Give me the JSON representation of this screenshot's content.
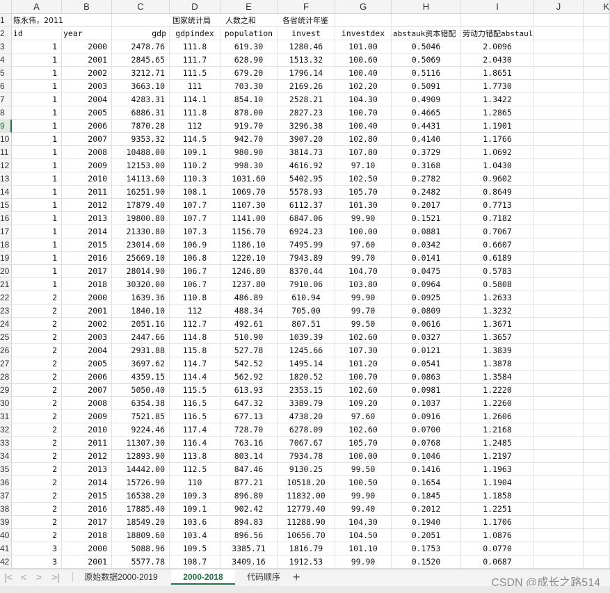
{
  "columns": [
    "A",
    "B",
    "C",
    "D",
    "E",
    "F",
    "G",
    "H",
    "I",
    "J",
    "K"
  ],
  "header_rows": {
    "row1": {
      "rownum": "1",
      "A": "陈永伟，2011",
      "D": "国家统计局",
      "E": "人数之和",
      "F": "各省统计年鉴"
    },
    "row2": {
      "rownum": "2",
      "A": "id",
      "B": "year",
      "C": "gdp",
      "D": "gdpindex",
      "E": "population",
      "F": "invest",
      "G": "investdex",
      "H": "abstauk资本错配",
      "I": "劳动力错配abstaul"
    }
  },
  "rows": [
    {
      "rn": "3",
      "id": "1",
      "year": "2000",
      "gdp": "2478.76",
      "gdpindex": "111.8",
      "population": "619.30",
      "invest": "1280.46",
      "investdex": "101.00",
      "abstauk": "0.5046",
      "abstaul": "2.0096"
    },
    {
      "rn": "4",
      "id": "1",
      "year": "2001",
      "gdp": "2845.65",
      "gdpindex": "111.7",
      "population": "628.90",
      "invest": "1513.32",
      "investdex": "100.60",
      "abstauk": "0.5069",
      "abstaul": "2.0430"
    },
    {
      "rn": "5",
      "id": "1",
      "year": "2002",
      "gdp": "3212.71",
      "gdpindex": "111.5",
      "population": "679.20",
      "invest": "1796.14",
      "investdex": "100.40",
      "abstauk": "0.5116",
      "abstaul": "1.8651"
    },
    {
      "rn": "6",
      "id": "1",
      "year": "2003",
      "gdp": "3663.10",
      "gdpindex": "111",
      "population": "703.30",
      "invest": "2169.26",
      "investdex": "102.20",
      "abstauk": "0.5091",
      "abstaul": "1.7730"
    },
    {
      "rn": "7",
      "id": "1",
      "year": "2004",
      "gdp": "4283.31",
      "gdpindex": "114.1",
      "population": "854.10",
      "invest": "2528.21",
      "investdex": "104.30",
      "abstauk": "0.4909",
      "abstaul": "1.3422"
    },
    {
      "rn": "8",
      "id": "1",
      "year": "2005",
      "gdp": "6886.31",
      "gdpindex": "111.8",
      "population": "878.00",
      "invest": "2827.23",
      "investdex": "100.70",
      "abstauk": "0.4665",
      "abstaul": "1.2865"
    },
    {
      "rn": "9",
      "id": "1",
      "year": "2006",
      "gdp": "7870.28",
      "gdpindex": "112",
      "population": "919.70",
      "invest": "3296.38",
      "investdex": "100.40",
      "abstauk": "0.4431",
      "abstaul": "1.1901",
      "selected": true
    },
    {
      "rn": "10",
      "id": "1",
      "year": "2007",
      "gdp": "9353.32",
      "gdpindex": "114.5",
      "population": "942.70",
      "invest": "3907.20",
      "investdex": "102.80",
      "abstauk": "0.4140",
      "abstaul": "1.1766"
    },
    {
      "rn": "11",
      "id": "1",
      "year": "2008",
      "gdp": "10488.00",
      "gdpindex": "109.1",
      "population": "980.90",
      "invest": "3814.73",
      "investdex": "107.80",
      "abstauk": "0.3729",
      "abstaul": "1.0692"
    },
    {
      "rn": "12",
      "id": "1",
      "year": "2009",
      "gdp": "12153.00",
      "gdpindex": "110.2",
      "population": "998.30",
      "invest": "4616.92",
      "investdex": "97.10",
      "abstauk": "0.3168",
      "abstaul": "1.0430"
    },
    {
      "rn": "13",
      "id": "1",
      "year": "2010",
      "gdp": "14113.60",
      "gdpindex": "110.3",
      "population": "1031.60",
      "invest": "5402.95",
      "investdex": "102.50",
      "abstauk": "0.2782",
      "abstaul": "0.9602"
    },
    {
      "rn": "14",
      "id": "1",
      "year": "2011",
      "gdp": "16251.90",
      "gdpindex": "108.1",
      "population": "1069.70",
      "invest": "5578.93",
      "investdex": "105.70",
      "abstauk": "0.2482",
      "abstaul": "0.8649"
    },
    {
      "rn": "15",
      "id": "1",
      "year": "2012",
      "gdp": "17879.40",
      "gdpindex": "107.7",
      "population": "1107.30",
      "invest": "6112.37",
      "investdex": "101.30",
      "abstauk": "0.2017",
      "abstaul": "0.7713"
    },
    {
      "rn": "16",
      "id": "1",
      "year": "2013",
      "gdp": "19800.80",
      "gdpindex": "107.7",
      "population": "1141.00",
      "invest": "6847.06",
      "investdex": "99.90",
      "abstauk": "0.1521",
      "abstaul": "0.7182"
    },
    {
      "rn": "17",
      "id": "1",
      "year": "2014",
      "gdp": "21330.80",
      "gdpindex": "107.3",
      "population": "1156.70",
      "invest": "6924.23",
      "investdex": "100.00",
      "abstauk": "0.0881",
      "abstaul": "0.7067"
    },
    {
      "rn": "18",
      "id": "1",
      "year": "2015",
      "gdp": "23014.60",
      "gdpindex": "106.9",
      "population": "1186.10",
      "invest": "7495.99",
      "investdex": "97.60",
      "abstauk": "0.0342",
      "abstaul": "0.6607"
    },
    {
      "rn": "19",
      "id": "1",
      "year": "2016",
      "gdp": "25669.10",
      "gdpindex": "106.8",
      "population": "1220.10",
      "invest": "7943.89",
      "investdex": "99.70",
      "abstauk": "0.0141",
      "abstaul": "0.6189"
    },
    {
      "rn": "20",
      "id": "1",
      "year": "2017",
      "gdp": "28014.90",
      "gdpindex": "106.7",
      "population": "1246.80",
      "invest": "8370.44",
      "investdex": "104.70",
      "abstauk": "0.0475",
      "abstaul": "0.5783"
    },
    {
      "rn": "21",
      "id": "1",
      "year": "2018",
      "gdp": "30320.00",
      "gdpindex": "106.7",
      "population": "1237.80",
      "invest": "7910.06",
      "investdex": "103.80",
      "abstauk": "0.0964",
      "abstaul": "0.5808"
    },
    {
      "rn": "22",
      "id": "2",
      "year": "2000",
      "gdp": "1639.36",
      "gdpindex": "110.8",
      "population": "486.89",
      "invest": "610.94",
      "investdex": "99.90",
      "abstauk": "0.0925",
      "abstaul": "1.2633"
    },
    {
      "rn": "23",
      "id": "2",
      "year": "2001",
      "gdp": "1840.10",
      "gdpindex": "112",
      "population": "488.34",
      "invest": "705.00",
      "investdex": "99.70",
      "abstauk": "0.0809",
      "abstaul": "1.3232"
    },
    {
      "rn": "24",
      "id": "2",
      "year": "2002",
      "gdp": "2051.16",
      "gdpindex": "112.7",
      "population": "492.61",
      "invest": "807.51",
      "investdex": "99.50",
      "abstauk": "0.0616",
      "abstaul": "1.3671"
    },
    {
      "rn": "25",
      "id": "2",
      "year": "2003",
      "gdp": "2447.66",
      "gdpindex": "114.8",
      "population": "510.90",
      "invest": "1039.39",
      "investdex": "102.60",
      "abstauk": "0.0327",
      "abstaul": "1.3657"
    },
    {
      "rn": "26",
      "id": "2",
      "year": "2004",
      "gdp": "2931.88",
      "gdpindex": "115.8",
      "population": "527.78",
      "invest": "1245.66",
      "investdex": "107.30",
      "abstauk": "0.0121",
      "abstaul": "1.3839"
    },
    {
      "rn": "27",
      "id": "2",
      "year": "2005",
      "gdp": "3697.62",
      "gdpindex": "114.7",
      "population": "542.52",
      "invest": "1495.14",
      "investdex": "101.20",
      "abstauk": "0.0541",
      "abstaul": "1.3878"
    },
    {
      "rn": "28",
      "id": "2",
      "year": "2006",
      "gdp": "4359.15",
      "gdpindex": "114.4",
      "population": "562.92",
      "invest": "1820.52",
      "investdex": "100.70",
      "abstauk": "0.0863",
      "abstaul": "1.3584"
    },
    {
      "rn": "29",
      "id": "2",
      "year": "2007",
      "gdp": "5050.40",
      "gdpindex": "115.5",
      "population": "613.93",
      "invest": "2353.15",
      "investdex": "102.60",
      "abstauk": "0.0981",
      "abstaul": "1.2220"
    },
    {
      "rn": "30",
      "id": "2",
      "year": "2008",
      "gdp": "6354.38",
      "gdpindex": "116.5",
      "population": "647.32",
      "invest": "3389.79",
      "investdex": "109.20",
      "abstauk": "0.1037",
      "abstaul": "1.2260"
    },
    {
      "rn": "31",
      "id": "2",
      "year": "2009",
      "gdp": "7521.85",
      "gdpindex": "116.5",
      "population": "677.13",
      "invest": "4738.20",
      "investdex": "97.60",
      "abstauk": "0.0916",
      "abstaul": "1.2606"
    },
    {
      "rn": "32",
      "id": "2",
      "year": "2010",
      "gdp": "9224.46",
      "gdpindex": "117.4",
      "population": "728.70",
      "invest": "6278.09",
      "investdex": "102.60",
      "abstauk": "0.0700",
      "abstaul": "1.2168"
    },
    {
      "rn": "33",
      "id": "2",
      "year": "2011",
      "gdp": "11307.30",
      "gdpindex": "116.4",
      "population": "763.16",
      "invest": "7067.67",
      "investdex": "105.70",
      "abstauk": "0.0768",
      "abstaul": "1.2485"
    },
    {
      "rn": "34",
      "id": "2",
      "year": "2012",
      "gdp": "12893.90",
      "gdpindex": "113.8",
      "population": "803.14",
      "invest": "7934.78",
      "investdex": "100.00",
      "abstauk": "0.1046",
      "abstaul": "1.2197"
    },
    {
      "rn": "35",
      "id": "2",
      "year": "2013",
      "gdp": "14442.00",
      "gdpindex": "112.5",
      "population": "847.46",
      "invest": "9130.25",
      "investdex": "99.50",
      "abstauk": "0.1416",
      "abstaul": "1.1963"
    },
    {
      "rn": "36",
      "id": "2",
      "year": "2014",
      "gdp": "15726.90",
      "gdpindex": "110",
      "population": "877.21",
      "invest": "10518.20",
      "investdex": "100.50",
      "abstauk": "0.1654",
      "abstaul": "1.1904"
    },
    {
      "rn": "37",
      "id": "2",
      "year": "2015",
      "gdp": "16538.20",
      "gdpindex": "109.3",
      "population": "896.80",
      "invest": "11832.00",
      "investdex": "99.90",
      "abstauk": "0.1845",
      "abstaul": "1.1858"
    },
    {
      "rn": "38",
      "id": "2",
      "year": "2016",
      "gdp": "17885.40",
      "gdpindex": "109.1",
      "population": "902.42",
      "invest": "12779.40",
      "investdex": "99.40",
      "abstauk": "0.2012",
      "abstaul": "1.2251"
    },
    {
      "rn": "39",
      "id": "2",
      "year": "2017",
      "gdp": "18549.20",
      "gdpindex": "103.6",
      "population": "894.83",
      "invest": "11288.90",
      "investdex": "104.30",
      "abstauk": "0.1940",
      "abstaul": "1.1706"
    },
    {
      "rn": "40",
      "id": "2",
      "year": "2018",
      "gdp": "18809.60",
      "gdpindex": "103.4",
      "population": "896.56",
      "invest": "10656.70",
      "investdex": "104.50",
      "abstauk": "0.2051",
      "abstaul": "1.0876"
    },
    {
      "rn": "41",
      "id": "3",
      "year": "2000",
      "gdp": "5088.96",
      "gdpindex": "109.5",
      "population": "3385.71",
      "invest": "1816.79",
      "investdex": "101.10",
      "abstauk": "0.1753",
      "abstaul": "0.0770"
    },
    {
      "rn": "42",
      "id": "3",
      "year": "2001",
      "gdp": "5577.78",
      "gdpindex": "108.7",
      "population": "3409.16",
      "invest": "1912.53",
      "investdex": "99.90",
      "abstauk": "0.1520",
      "abstaul": "0.0687"
    }
  ],
  "sheet_tabs": [
    {
      "label": "原始数据2000-2019",
      "active": false
    },
    {
      "label": "2000-2018",
      "active": true
    },
    {
      "label": "代码顺序",
      "active": false
    }
  ],
  "nav_icons": [
    "first-sheet-icon",
    "prev-sheet-icon",
    "next-sheet-icon",
    "last-sheet-icon"
  ],
  "add_sheet_glyph": "+",
  "watermark": "CSDN @成长之路514",
  "colors": {
    "accent": "#217346",
    "header_bg": "#f4f4f4",
    "gridline": "#e2e2e2"
  }
}
